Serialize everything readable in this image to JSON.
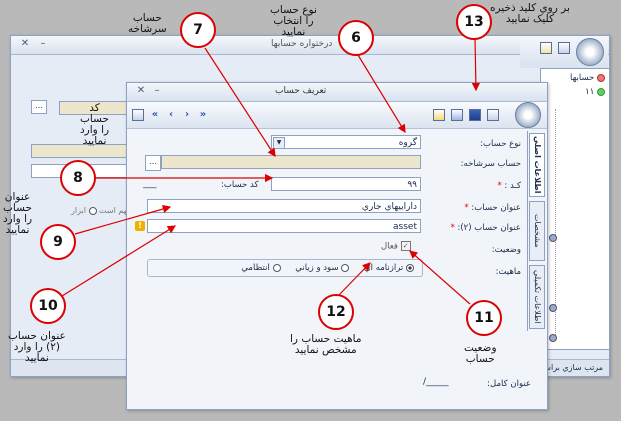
{
  "bg_window": {
    "title": "درختواره حسابها",
    "behind_labels": [
      "مهم است",
      "ابزار"
    ],
    "status_text": "مرتب سازي براسا"
  },
  "dialog": {
    "title": "تعريف حساب",
    "tabs": [
      "اطلاعات اصلي",
      "مشخصات",
      "اطلاعات تکميلي"
    ],
    "form": {
      "account_type_label": "نوع حساب:",
      "account_type_value": "گروه",
      "parent_label": "حساب سرشاخه:",
      "code_label": "کـد :",
      "code_value": "۹۹",
      "account_code_label": "کد حساب:",
      "account_code_value": "___",
      "title_label": "عنوان حساب:",
      "title_value": "داراييهاي جاري",
      "title2_label": "عنوان حساب (۲):",
      "title2_value": "asset",
      "status_label": "وضعيت:",
      "active_label": "فعال",
      "nature_label": "ماهيت:",
      "nature_options": [
        "ترازنامه اي",
        "سود و زياني",
        "انتظامي"
      ],
      "full_title_label": "عنوان کامل:",
      "full_title_value": "/_____"
    }
  },
  "tree": {
    "items": [
      "حسابها",
      "۱۱"
    ]
  },
  "annotations": {
    "n6": "6",
    "t6": [
      "نوع حساب",
      "را انتخاب",
      "نماييد"
    ],
    "n7": "7",
    "t7": [
      "حساب",
      "سرشاخه"
    ],
    "n8": "8",
    "t8": [
      "کد",
      "حساب",
      "را وارد",
      "نماييد"
    ],
    "n9": "9",
    "t9": [
      "عنوان",
      "حساب",
      "را وارد",
      "نماييد"
    ],
    "n10": "10",
    "t10": [
      "عنوان حساب",
      "(۲) را وارد",
      "نماييد"
    ],
    "n11": "11",
    "t11": [
      "وضعيت",
      "حساب"
    ],
    "n12": "12",
    "t12": [
      "ماهيت حساب را",
      "مشخص نماييد"
    ],
    "n13": "13",
    "t13": [
      "بر روي کليد ذخيره",
      "کليک نماييد"
    ]
  },
  "colors": {
    "arrow": "#dd0000",
    "accent": "#2856b7"
  }
}
